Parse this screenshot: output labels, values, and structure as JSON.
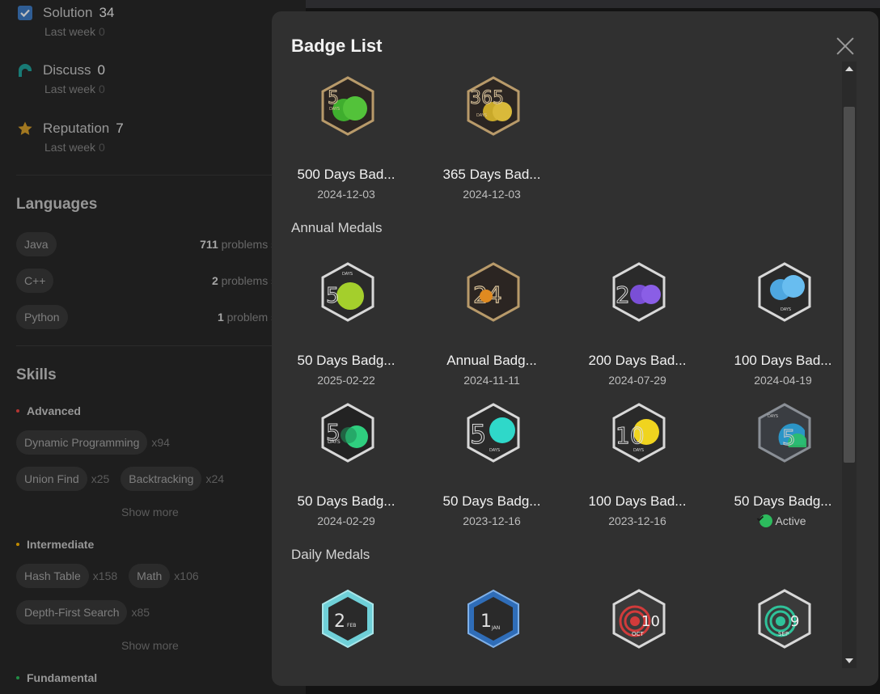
{
  "profile": {
    "stats": [
      {
        "label": "Solution",
        "count": "34",
        "sub_label": "Last week",
        "sub_value": "0",
        "icon": "checkbox-icon"
      },
      {
        "label": "Discuss",
        "count": "0",
        "sub_label": "Last week",
        "sub_value": "0",
        "icon": "discuss-icon"
      },
      {
        "label": "Reputation",
        "count": "7",
        "sub_label": "Last week",
        "sub_value": "0",
        "icon": "star-icon"
      }
    ],
    "languages_title": "Languages",
    "languages": [
      {
        "name": "Java",
        "count": "711",
        "unit": "problems solv"
      },
      {
        "name": "C++",
        "count": "2",
        "unit": "problems solv"
      },
      {
        "name": "Python",
        "count": "1",
        "unit": "problem solv"
      }
    ],
    "skills_title": "Skills",
    "levels": {
      "advanced": {
        "label": "Advanced",
        "color": "#ef4743"
      },
      "intermediate": {
        "label": "Intermediate",
        "color": "#ffb800"
      },
      "fundamental": {
        "label": "Fundamental",
        "color": "#2cbb5d"
      }
    },
    "advanced_tags": [
      {
        "name": "Dynamic Programming",
        "count": "x94"
      },
      {
        "name": "Union Find",
        "count": "x25"
      },
      {
        "name": "Backtracking",
        "count": "x24"
      }
    ],
    "intermediate_tags": [
      {
        "name": "Hash Table",
        "count": "x158"
      },
      {
        "name": "Math",
        "count": "x106"
      },
      {
        "name": "Depth-First Search",
        "count": "x85"
      }
    ],
    "show_more": "Show more"
  },
  "modal": {
    "title": "Badge List",
    "top_badges": [
      {
        "name": "500 Days Bad...",
        "date": "2024-12-03",
        "icon": "500-days-badge-icon"
      },
      {
        "name": "365 Days Bad...",
        "date": "2024-12-03",
        "icon": "365-days-badge-icon"
      }
    ],
    "annual_title": "Annual Medals",
    "annual_badges": [
      {
        "name": "50 Days Badg...",
        "date": "2025-02-22",
        "icon": "50-days-badge-icon"
      },
      {
        "name": "Annual Badg...",
        "date": "2024-11-11",
        "icon": "annual-badge-icon"
      },
      {
        "name": "200 Days Bad...",
        "date": "2024-07-29",
        "icon": "200-days-badge-icon"
      },
      {
        "name": "100 Days Bad...",
        "date": "2024-04-19",
        "icon": "100-days-badge-icon"
      },
      {
        "name": "50 Days Badg...",
        "date": "2024-02-29",
        "icon": "50-days-badge-icon"
      },
      {
        "name": "50 Days Badg...",
        "date": "2023-12-16",
        "icon": "50-days-badge-icon"
      },
      {
        "name": "100 Days Bad...",
        "date": "2023-12-16",
        "icon": "100-days-badge-icon"
      },
      {
        "name": "50 Days Badg...",
        "date": "Active",
        "icon": "50-days-badge-icon"
      }
    ],
    "daily_title": "Daily Medals",
    "daily_badges": [
      {
        "num": "2",
        "month": "FEB",
        "icon": "daily-feb-badge-icon"
      },
      {
        "num": "1",
        "month": "JAN",
        "icon": "daily-jan-badge-icon"
      },
      {
        "num": "10",
        "month": "OCT",
        "icon": "daily-oct-badge-icon"
      },
      {
        "num": "9",
        "month": "SEP",
        "icon": "daily-sep-badge-icon"
      }
    ]
  },
  "colors": {
    "accent_green": "#2cbb5d",
    "modal_bg": "#303030",
    "page_bg": "#282828"
  }
}
